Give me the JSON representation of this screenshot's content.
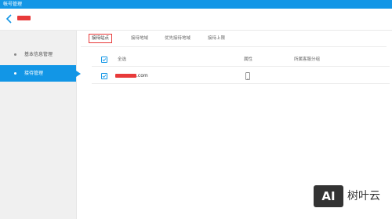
{
  "window": {
    "title": "帐号管理"
  },
  "header": {
    "back_icon": "chevron-left-icon"
  },
  "sidebar": {
    "items": [
      {
        "label": "基本信息管理",
        "active": false
      },
      {
        "label": "接待管理",
        "active": true
      }
    ]
  },
  "tabs": [
    {
      "label": "接待站点",
      "active": true
    },
    {
      "label": "接待地域",
      "active": false
    },
    {
      "label": "优先接待地域",
      "active": false
    },
    {
      "label": "接待上限",
      "active": false
    }
  ],
  "table": {
    "headers": {
      "select_all": "全选",
      "attribute": "属性",
      "group": "所属客服分组"
    },
    "rows": [
      {
        "site_suffix": ".com",
        "attribute_icon": "mobile-phone-icon",
        "group": ""
      }
    ]
  },
  "watermark": {
    "logo_text": "AI",
    "text": "树叶云"
  },
  "colors": {
    "accent": "#1296e6",
    "highlight": "#e83a3a",
    "sidebar_bg": "#f0f0f0"
  }
}
